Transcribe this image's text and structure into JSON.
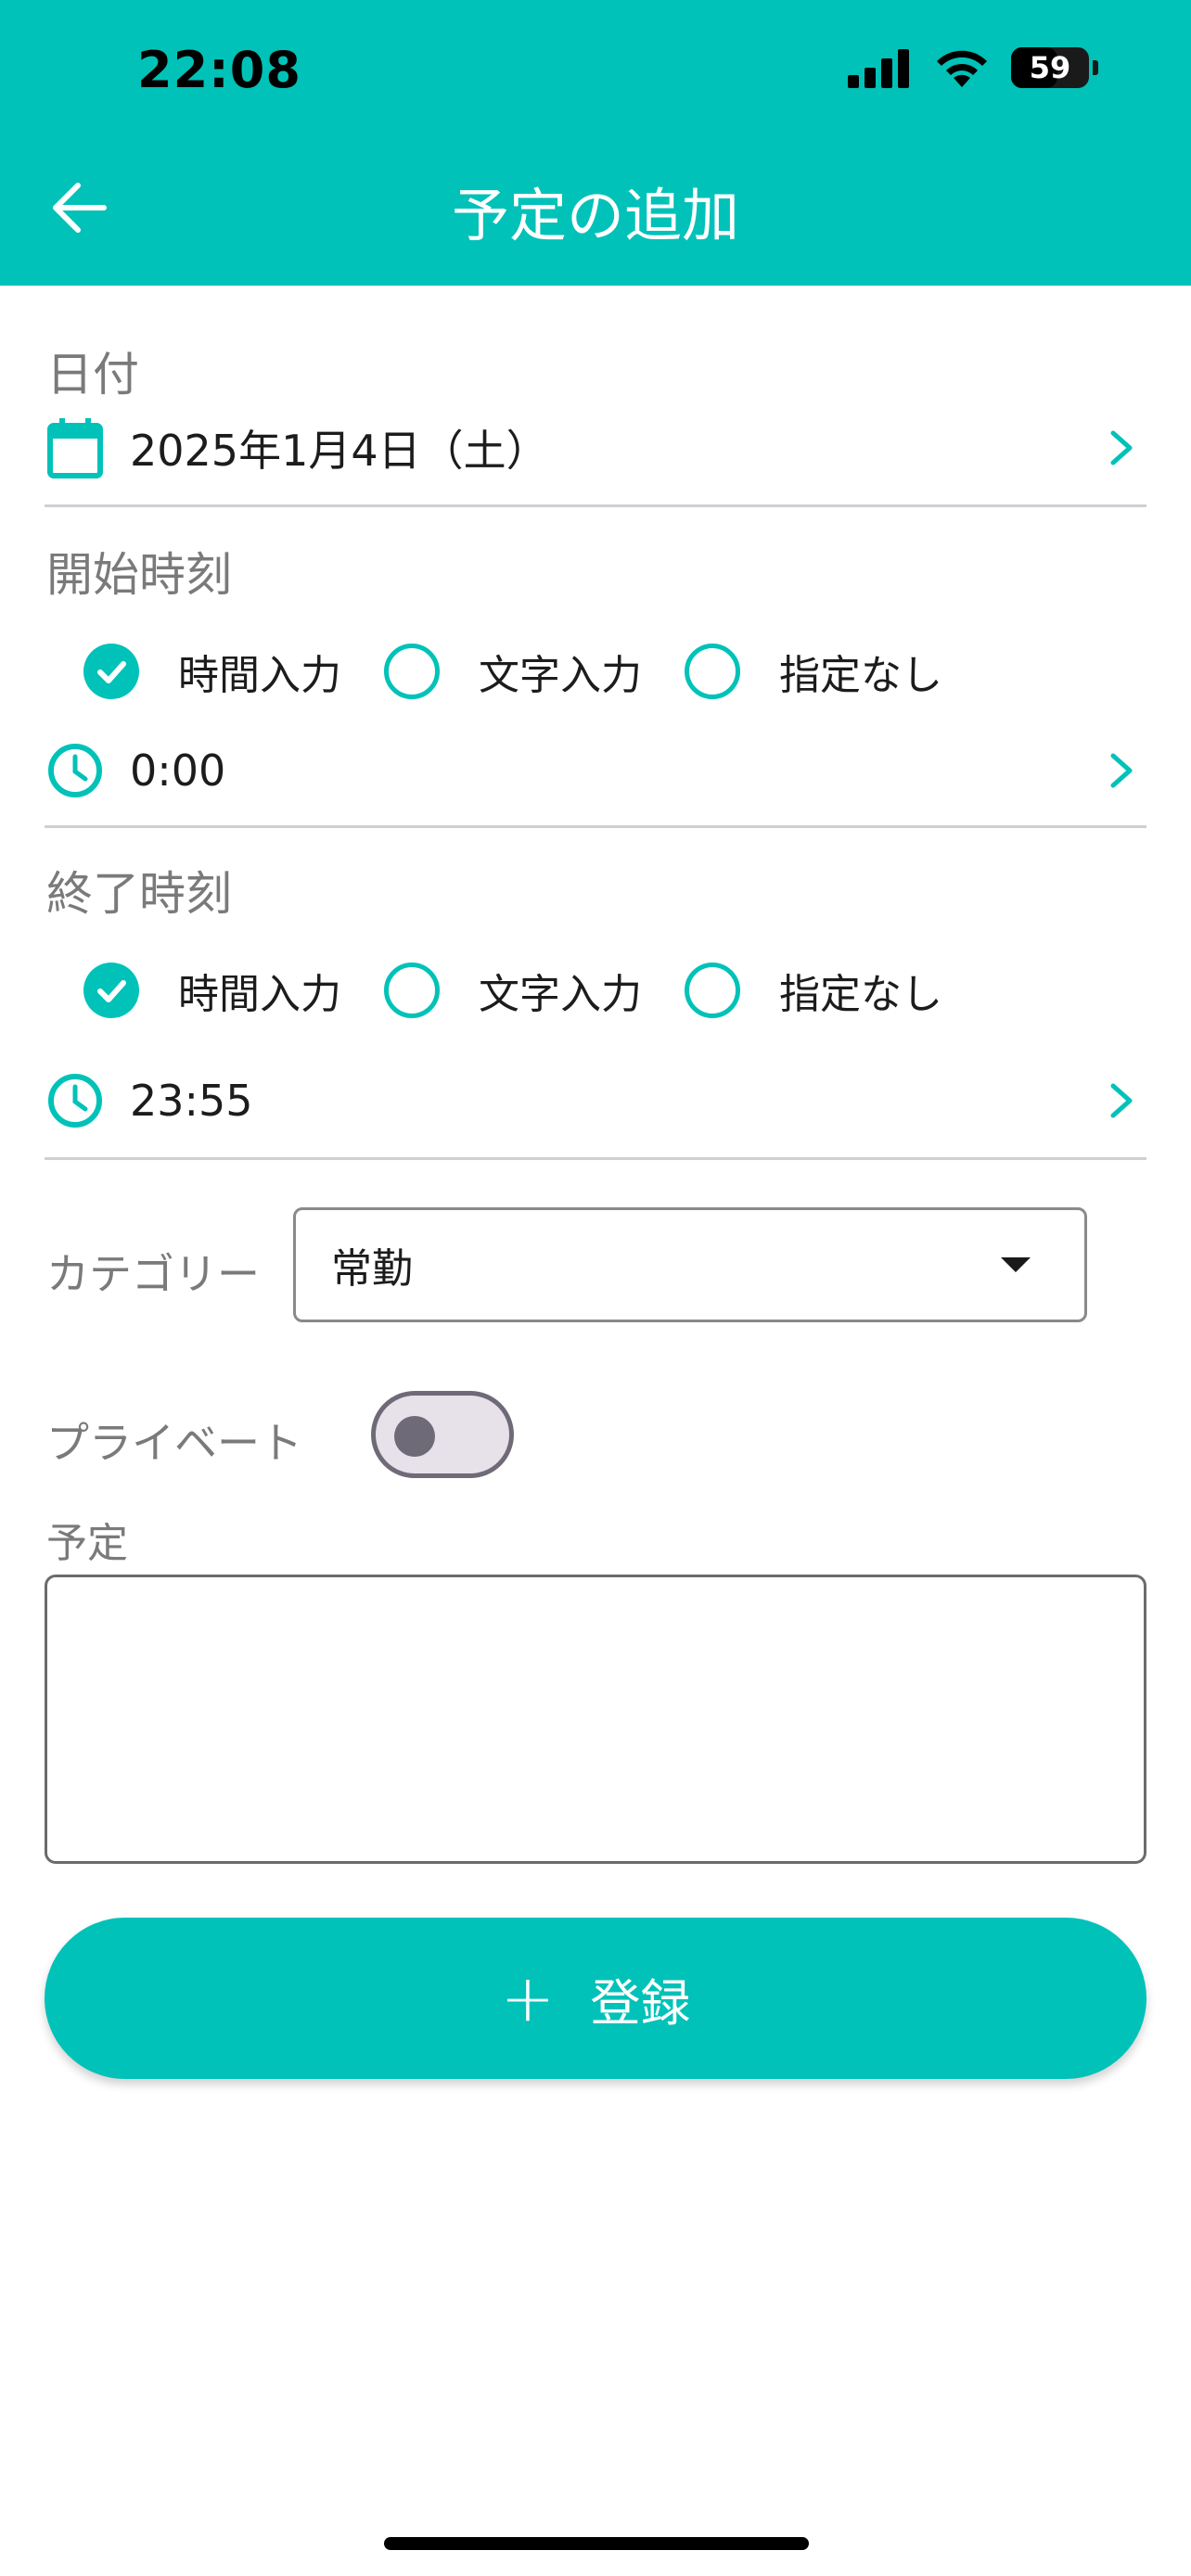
{
  "status_bar": {
    "time": "22:08",
    "battery": "59"
  },
  "header": {
    "title": "予定の追加"
  },
  "date": {
    "label": "日付",
    "value": "2025年1月4日（土）"
  },
  "start": {
    "label": "開始時刻",
    "options": [
      "時間入力",
      "文字入力",
      "指定なし"
    ],
    "selected": "時間入力",
    "time": "0:00"
  },
  "end": {
    "label": "終了時刻",
    "options": [
      "時間入力",
      "文字入力",
      "指定なし"
    ],
    "selected": "時間入力",
    "time": "23:55"
  },
  "category": {
    "label": "カテゴリー",
    "value": "常勤"
  },
  "private": {
    "label": "プライベート",
    "on": false
  },
  "memo": {
    "label": "予定",
    "value": ""
  },
  "register": {
    "label": "登録"
  },
  "colors": {
    "accent": "#00c2b8"
  }
}
